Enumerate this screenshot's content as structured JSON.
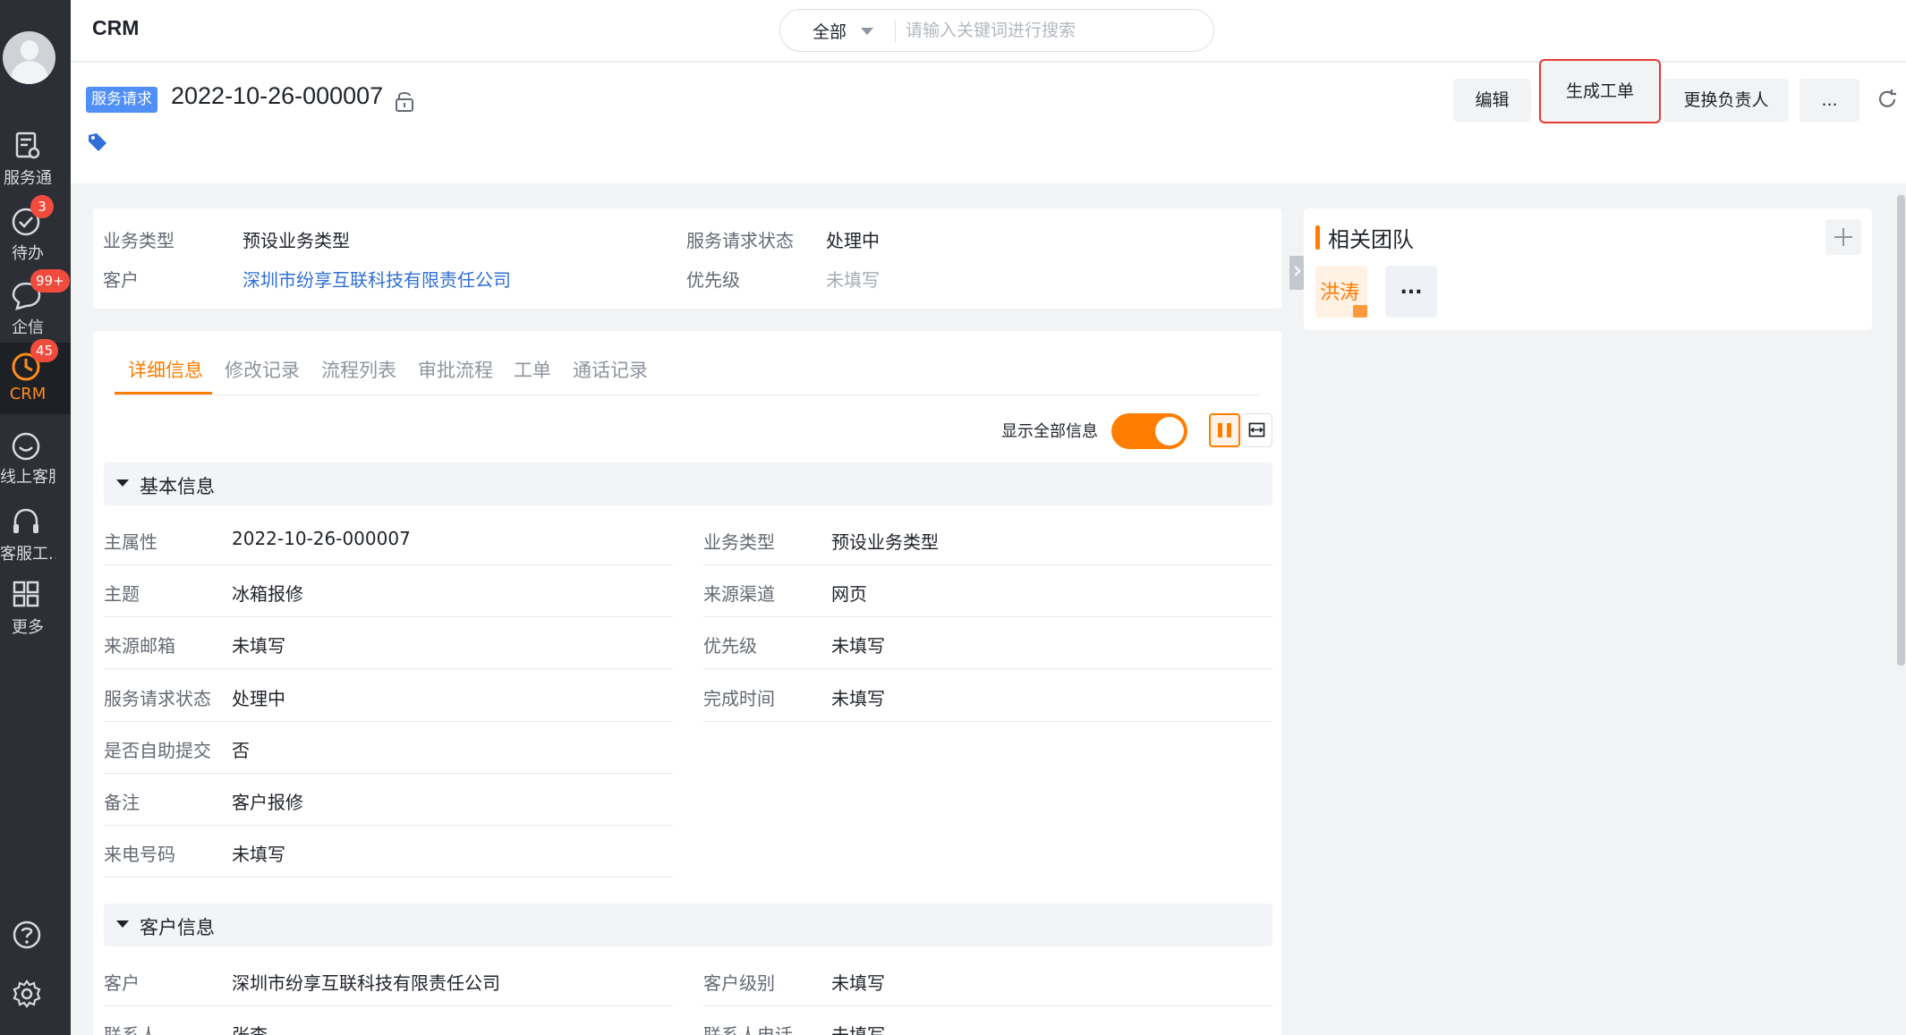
{
  "sidebar": {
    "items": [
      {
        "label": "服务通",
        "icon": "service-icon"
      },
      {
        "label": "待办",
        "icon": "check-circle-icon",
        "badge": "3"
      },
      {
        "label": "企信",
        "icon": "chat-icon",
        "badge": "99+"
      },
      {
        "label": "CRM",
        "icon": "crm-icon",
        "badge": "45",
        "active": true
      },
      {
        "label": "线上客服",
        "icon": "smile-icon"
      },
      {
        "label": "客服工...",
        "icon": "headset-icon"
      },
      {
        "label": "更多",
        "icon": "grid-icon"
      }
    ],
    "bottom_icons": [
      "help-icon",
      "gear-icon"
    ]
  },
  "topbar": {
    "title": "CRM",
    "search_scope": "全部",
    "search_placeholder": "请输入关键词进行搜索"
  },
  "record": {
    "type_tag": "服务请求",
    "id": "2022-10-26-000007",
    "buttons": {
      "edit": "编辑",
      "generate_order": "生成工单",
      "change_owner": "更换负责人",
      "more": "..."
    }
  },
  "summary": {
    "business_type_label": "业务类型",
    "business_type_value": "预设业务类型",
    "status_label": "服务请求状态",
    "status_value": "处理中",
    "customer_label": "客户",
    "customer_value": "深圳市纷享互联科技有限责任公司",
    "priority_label": "优先级",
    "priority_value": "未填写"
  },
  "tabs": [
    "详细信息",
    "修改记录",
    "流程列表",
    "审批流程",
    "工单",
    "通话记录"
  ],
  "detail": {
    "show_all_label": "显示全部信息",
    "basic_section_title": "基本信息",
    "basic_left": [
      {
        "label": "主属性",
        "value": "2022-10-26-000007"
      },
      {
        "label": "主题",
        "value": "冰箱报修"
      },
      {
        "label": "来源邮箱",
        "value": "未填写"
      },
      {
        "label": "服务请求状态",
        "value": "处理中"
      },
      {
        "label": "是否自助提交",
        "value": "否"
      },
      {
        "label": "备注",
        "value": "客户报修"
      },
      {
        "label": "来电号码",
        "value": "未填写"
      }
    ],
    "basic_right": [
      {
        "label": "业务类型",
        "value": "预设业务类型"
      },
      {
        "label": "来源渠道",
        "value": "网页"
      },
      {
        "label": "优先级",
        "value": "未填写"
      },
      {
        "label": "完成时间",
        "value": "未填写"
      }
    ],
    "customer_section_title": "客户信息",
    "customer_left": [
      {
        "label": "客户",
        "value": "深圳市纷享互联科技有限责任公司"
      },
      {
        "label": "联系人",
        "value": "张李"
      }
    ],
    "customer_right": [
      {
        "label": "客户级别",
        "value": "未填写"
      },
      {
        "label": "联系人电话",
        "value": "未填写"
      }
    ]
  },
  "team": {
    "title": "相关团队",
    "member_name": "洪涛",
    "more": "..."
  },
  "colors": {
    "accent": "#ff7d00",
    "link": "#2f6fd6",
    "tag_blue": "#4f8ff7",
    "sidebar_bg": "#2c2f36",
    "badge_red": "#f04b3c"
  }
}
